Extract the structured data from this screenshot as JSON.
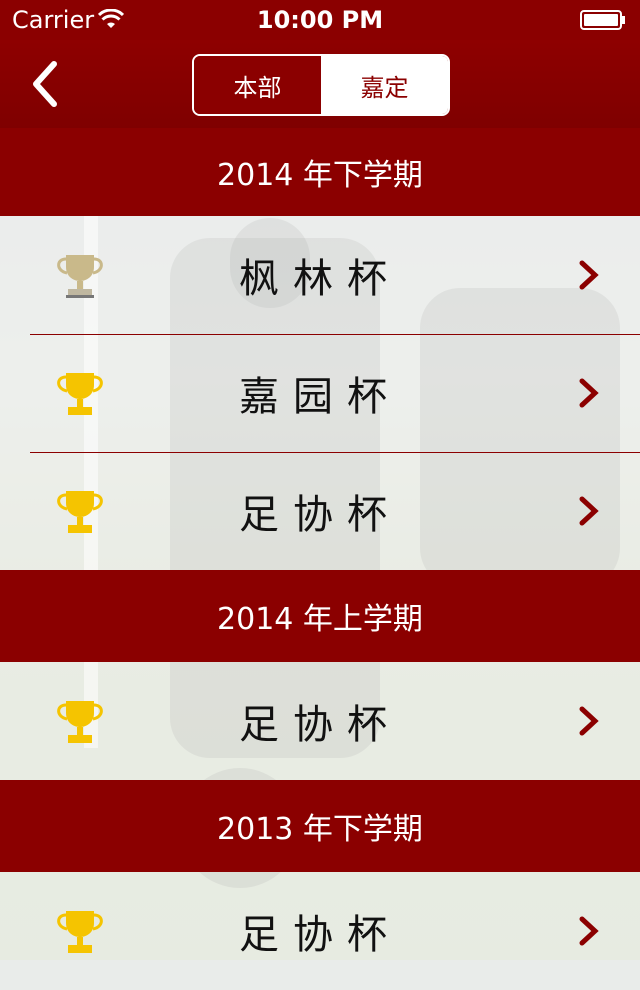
{
  "status": {
    "carrier": "Carrier",
    "time": "10:00 PM"
  },
  "nav": {
    "back_icon": "chevron-left-icon",
    "segments": [
      {
        "label": "本部",
        "selected": false
      },
      {
        "label": "嘉定",
        "selected": true
      }
    ]
  },
  "sections": [
    {
      "title": "2014 年下学期",
      "items": [
        {
          "label": "枫林杯",
          "trophy": "silver"
        },
        {
          "label": "嘉园杯",
          "trophy": "gold"
        },
        {
          "label": "足协杯",
          "trophy": "gold"
        }
      ]
    },
    {
      "title": "2014 年上学期",
      "items": [
        {
          "label": "足协杯",
          "trophy": "gold"
        }
      ]
    },
    {
      "title": "2013 年下学期",
      "items": [
        {
          "label": "足协杯",
          "trophy": "gold"
        }
      ]
    }
  ],
  "colors": {
    "brand": "#8b0000",
    "gold": "#f5c400",
    "silver": "#c9b98a"
  }
}
